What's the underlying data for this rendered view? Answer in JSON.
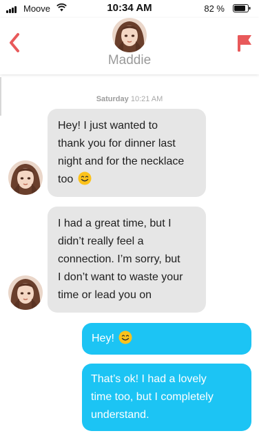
{
  "status_bar": {
    "carrier": "Moove",
    "time": "10:34 AM",
    "battery": "82 %"
  },
  "header": {
    "contact_name": "Maddie",
    "back_icon": "chevron-left-icon",
    "flag_icon": "flag-icon",
    "accent_color": "#e8595a"
  },
  "timestamp": {
    "day": "Saturday",
    "time": "10:21 AM"
  },
  "messages": [
    {
      "direction": "in",
      "lines": [
        "Hey! I just wanted to",
        "thank you for dinner last",
        "night and for the necklace",
        "too"
      ],
      "emoji": "smiling-face-emoji"
    },
    {
      "direction": "in",
      "lines": [
        "I had a great time, but I",
        "didn’t really feel a",
        "connection. I’m sorry, but",
        "I don’t want to waste your",
        "time or lead you on"
      ]
    },
    {
      "direction": "out",
      "lines": [
        "Hey!"
      ],
      "emoji": "smiling-face-emoji"
    },
    {
      "direction": "out",
      "lines": [
        "That’s ok! I had a lovely",
        "time too, but I completely",
        "understand."
      ]
    }
  ],
  "colors": {
    "incoming_bubble": "#e6e6e6",
    "outgoing_bubble": "#1cc4f4"
  }
}
